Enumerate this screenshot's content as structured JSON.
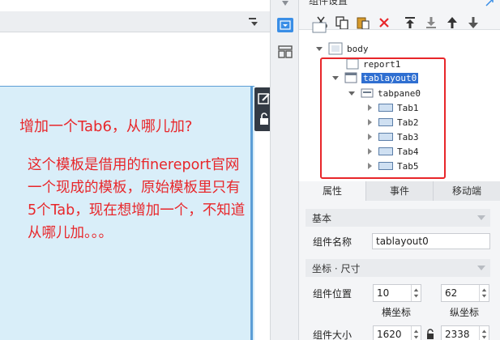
{
  "colors": {
    "accent": "#3a8ee6",
    "selection": "#2f6fd1",
    "annotation_red": "#e8262a",
    "tab_area": "#d9eef9"
  },
  "canvas": {
    "annotation_title": "增加一个Tab6，从哪儿加?",
    "annotation_lines": [
      "这个模板是借用的finereport官网",
      "一个现成的模板，原始模板里只有",
      "5个Tab，现在想增加一个，不知道",
      "从哪儿加。。。"
    ]
  },
  "panel": {
    "title": "组件设置",
    "toolbar_icons": [
      "cut-icon",
      "copy-icon",
      "paste-icon",
      "delete-icon",
      "move-to-top-icon",
      "move-to-bottom-icon",
      "move-up-icon",
      "move-down-icon"
    ],
    "tree": {
      "nodes": [
        "body",
        "report1",
        "tablayout0",
        "tabpane0",
        "Tab1",
        "Tab2",
        "Tab3",
        "Tab4",
        "Tab5"
      ]
    },
    "prop_tabs": [
      "属性",
      "事件",
      "移动端"
    ],
    "basic": {
      "section_label": "基本",
      "name_label": "组件名称",
      "name_value": "tablayout0"
    },
    "bounds": {
      "section_label": "坐标 · 尺寸",
      "position_label": "组件位置",
      "x_value": "10",
      "y_value": "62",
      "x_label": "横坐标",
      "y_label": "纵坐标",
      "size_label": "组件大小",
      "width_value": "1620",
      "height_value": "2338"
    }
  }
}
